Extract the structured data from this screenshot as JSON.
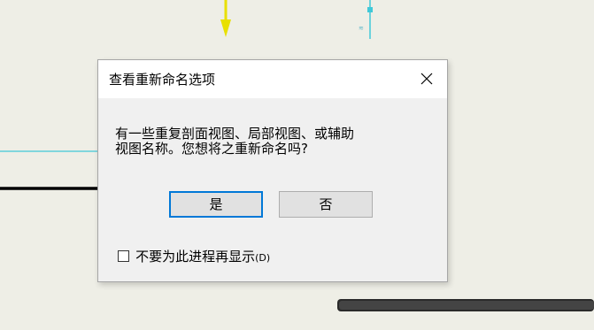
{
  "dialog": {
    "title": "查看重新命名选项",
    "message_line1": "有一些重复剖面视图、局部视图、或辅助",
    "message_line2": "视图名称。您想将之重新命名吗?",
    "yes_label": "是",
    "no_label": "否",
    "checkbox_label": "不要为此进程再显示",
    "checkbox_accelerator": "(D)",
    "checkbox_checked": false
  },
  "colors": {
    "canvas_bg": "#eeeee6",
    "focus_border": "#0078d7",
    "cyan_line": "#40c8d8",
    "yellow_arrow": "#e8e000"
  }
}
